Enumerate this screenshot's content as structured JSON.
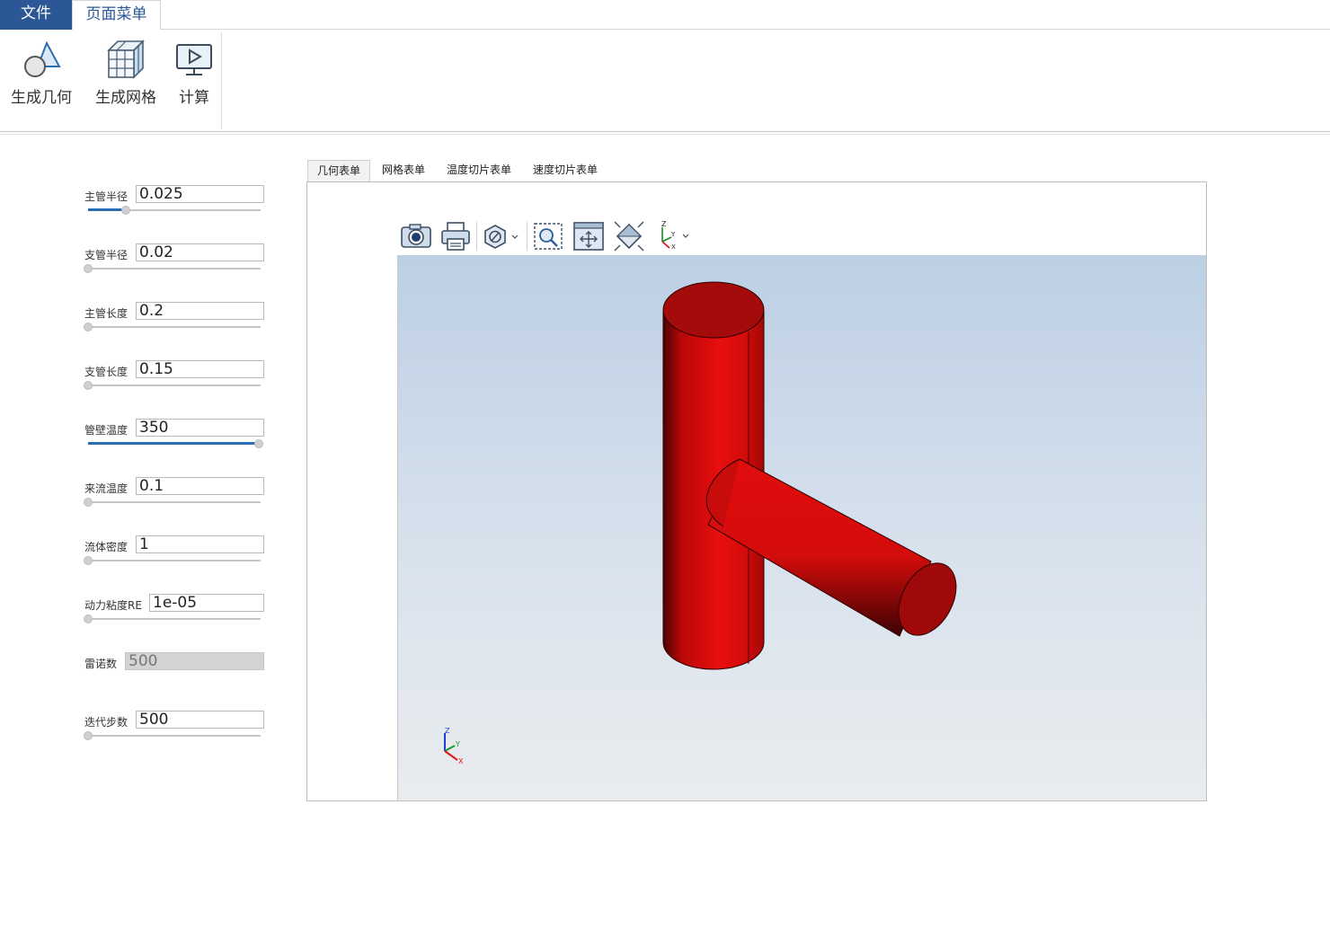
{
  "ribbon": {
    "tabs": [
      "文件",
      "页面菜单"
    ],
    "buttons": {
      "geometry": "生成几何",
      "mesh": "生成网格",
      "compute": "计算"
    }
  },
  "params": [
    {
      "label": "主管半径",
      "value": "0.025",
      "slider": 0.22
    },
    {
      "label": "支管半径",
      "value": "0.02",
      "slider": 0.0
    },
    {
      "label": "主管长度",
      "value": "0.2",
      "slider": 0.0
    },
    {
      "label": "支管长度",
      "value": "0.15",
      "slider": 0.0
    },
    {
      "label": "管壁温度",
      "value": "350",
      "slider": 1.0
    },
    {
      "label": "来流温度",
      "value": "0.1",
      "slider": 0.0
    },
    {
      "label": "流体密度",
      "value": "1",
      "slider": 0.0
    },
    {
      "label": "动力粘度RE",
      "value": "1e-05",
      "slider": 0.0
    },
    {
      "label": "雷诺数",
      "value": "500",
      "disabled": true
    },
    {
      "label": "迭代步数",
      "value": "500",
      "slider": 0.0
    }
  ],
  "form_tabs": [
    "几何表单",
    "网格表单",
    "温度切片表单",
    "速度切片表单"
  ],
  "active_form_tab": "几何表单",
  "viewer": {
    "toolbar": [
      "camera-icon",
      "print-icon",
      "clip-icon",
      "zoom-box-icon",
      "fit-view-icon",
      "reset-view-icon",
      "axes-orientation-icon"
    ],
    "axes": {
      "z": "Z",
      "y": "Y",
      "x": "X"
    },
    "model_color": "#e00d0d"
  },
  "colors": {
    "accent": "#2b5797",
    "slider_fill": "#2a6fb4"
  }
}
